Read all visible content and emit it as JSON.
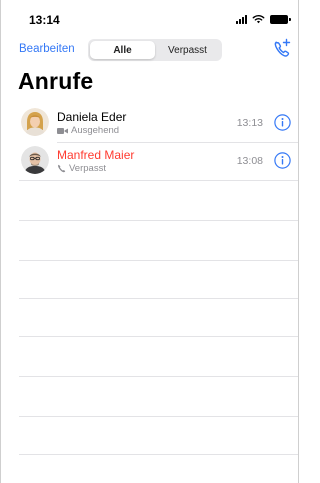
{
  "status_bar": {
    "time": "13:14",
    "icons": [
      "signal-icon",
      "wifi-icon",
      "battery-icon"
    ]
  },
  "nav": {
    "edit_label": "Bearbeiten",
    "segments": [
      {
        "label": "Alle",
        "selected": true
      },
      {
        "label": "Verpasst",
        "selected": false
      }
    ],
    "add_call_icon": "phone-plus-icon"
  },
  "title": "Anrufe",
  "calls": [
    {
      "name": "Daniela Eder",
      "type": "Ausgehend",
      "type_icon": "video-camera-icon",
      "time": "13:13",
      "missed": false,
      "avatar_icon": "avatar-woman-icon"
    },
    {
      "name": "Manfred  Maier",
      "type": "Verpasst",
      "type_icon": "phone-icon",
      "time": "13:08",
      "missed": true,
      "avatar_icon": "avatar-man-icon"
    }
  ],
  "colors": {
    "accent": "#3478f6",
    "missed": "#ff3b30",
    "secondary_text": "#8e8e93",
    "separator": "#e3e3e6"
  }
}
